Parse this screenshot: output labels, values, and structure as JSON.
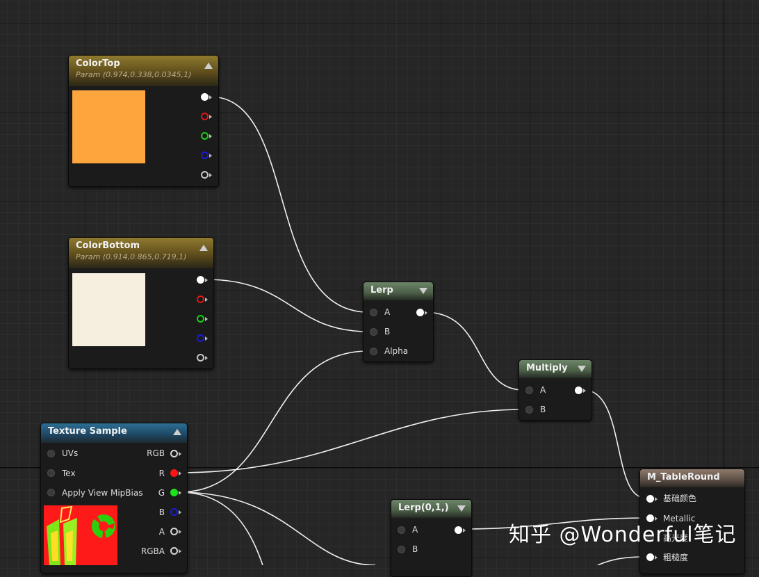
{
  "nodes": {
    "color_top": {
      "title": "ColorTop",
      "subtitle": "Param (0.974,0.338,0.0345,1)",
      "swatch_color": "#ffa53e"
    },
    "color_bottom": {
      "title": "ColorBottom",
      "subtitle": "Param (0.914,0.865,0.719,1)",
      "swatch_color": "#f6efe0"
    },
    "texture_sample": {
      "title": "Texture Sample",
      "inputs": [
        "UVs",
        "Tex",
        "Apply View MipBias"
      ],
      "outputs": [
        "RGB",
        "R",
        "G",
        "B",
        "A",
        "RGBA"
      ]
    },
    "lerp": {
      "title": "Lerp",
      "inputs": [
        "A",
        "B",
        "Alpha"
      ]
    },
    "multiply": {
      "title": "Multiply",
      "inputs": [
        "A",
        "B"
      ]
    },
    "lerp01": {
      "title": "Lerp(0,1,)",
      "inputs": [
        "A",
        "B"
      ]
    },
    "material": {
      "title": "M_TableRound",
      "inputs": [
        "基础颜色",
        "Metallic",
        "高光度",
        "粗糙度"
      ]
    }
  },
  "watermark": "知乎 @Wonderful笔记",
  "colors": {
    "param_header": "#8f7a2e",
    "texture_header": "#2d6e94",
    "math_header": "#6c8568",
    "result_header": "#8e7a6b",
    "wire": "#f0f0f0",
    "pin_red": "#e01818",
    "pin_green": "#18d018",
    "pin_blue": "#1a1ae0"
  }
}
